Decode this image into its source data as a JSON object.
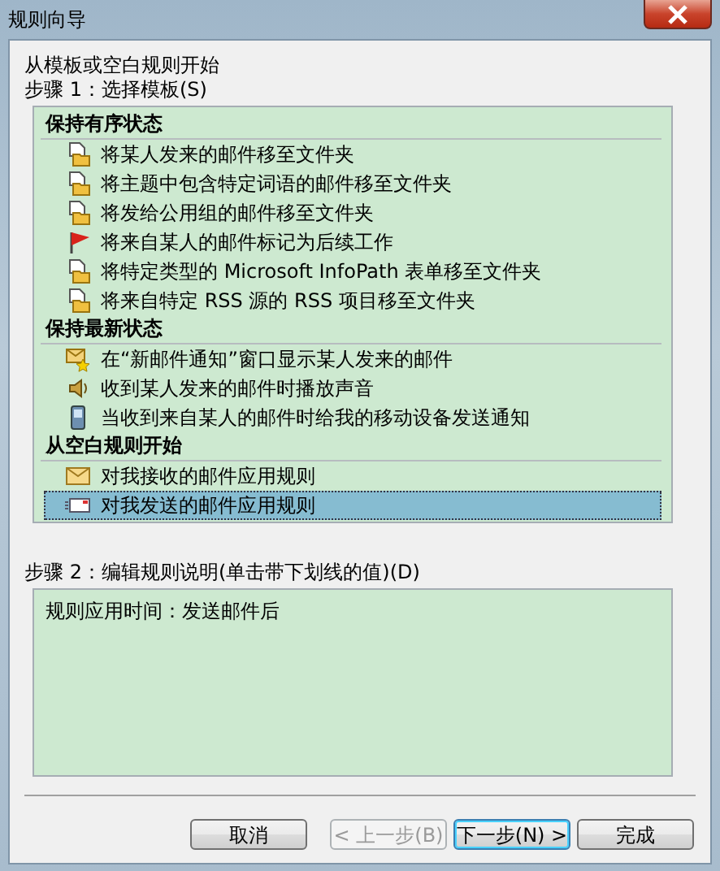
{
  "window": {
    "title": "规则向导"
  },
  "intro": "从模板或空白规则开始",
  "step1_label": "步骤 1：选择模板(S)",
  "groups": [
    {
      "heading": "保持有序状态",
      "items": [
        {
          "label": "将某人发来的邮件移至文件夹",
          "kind": "move",
          "selected": false
        },
        {
          "label": "将主题中包含特定词语的邮件移至文件夹",
          "kind": "move",
          "selected": false
        },
        {
          "label": "将发给公用组的邮件移至文件夹",
          "kind": "move",
          "selected": false
        },
        {
          "label": "将来自某人的邮件标记为后续工作",
          "kind": "flag",
          "selected": false
        },
        {
          "label": "将特定类型的 Microsoft InfoPath 表单移至文件夹",
          "kind": "move",
          "selected": false
        },
        {
          "label": "将来自特定 RSS 源的 RSS 项目移至文件夹",
          "kind": "move",
          "selected": false
        }
      ]
    },
    {
      "heading": "保持最新状态",
      "items": [
        {
          "label": "在“新邮件通知”窗口显示某人发来的邮件",
          "kind": "alert",
          "selected": false
        },
        {
          "label": "收到某人发来的邮件时播放声音",
          "kind": "sound",
          "selected": false
        },
        {
          "label": "当收到来自某人的邮件时给我的移动设备发送通知",
          "kind": "mobile",
          "selected": false
        }
      ]
    },
    {
      "heading": "从空白规则开始",
      "items": [
        {
          "label": "对我接收的邮件应用规则",
          "kind": "receive",
          "selected": false
        },
        {
          "label": "对我发送的邮件应用规则",
          "kind": "send",
          "selected": true
        }
      ]
    }
  ],
  "step2_label": "步骤 2：编辑规则说明(单击带下划线的值)(D)",
  "description": "规则应用时间：发送邮件后",
  "buttons": [
    {
      "label": "取消",
      "disabled": false,
      "default": false
    },
    {
      "label": "< 上一步(B)",
      "disabled": true,
      "default": false
    },
    {
      "label": "下一步(N) >",
      "disabled": false,
      "default": true
    },
    {
      "label": "完成",
      "disabled": false,
      "default": false
    }
  ]
}
